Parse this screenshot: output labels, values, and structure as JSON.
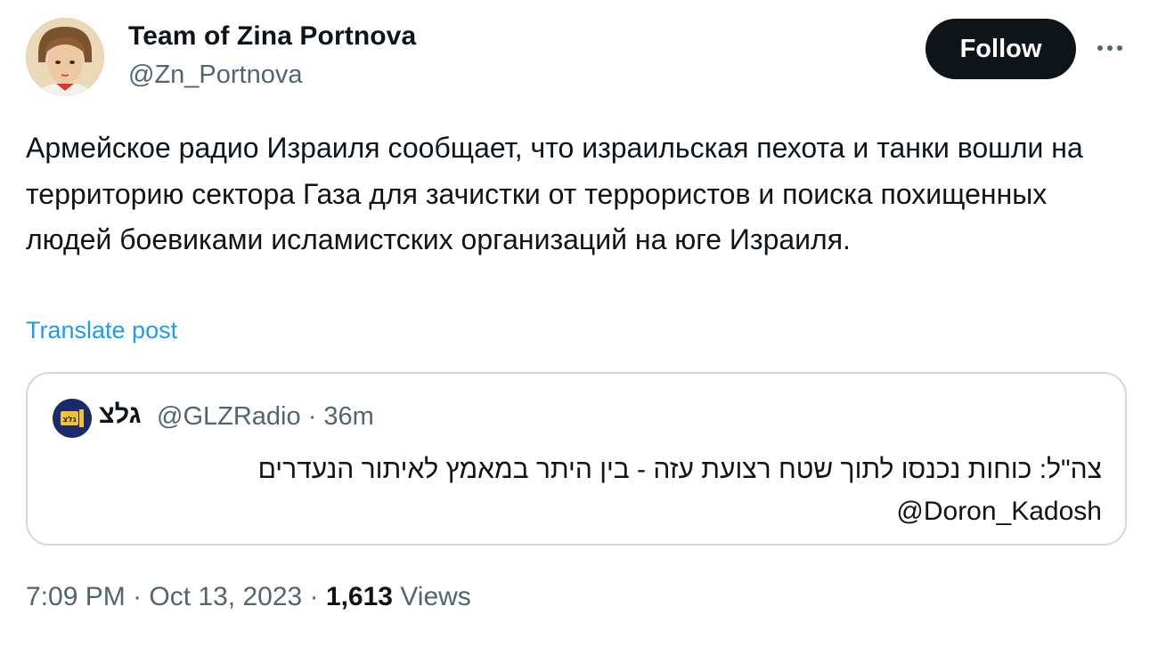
{
  "author": {
    "display_name": "Team of Zina Portnova",
    "handle": "@Zn_Portnova",
    "avatar_icon": "portrait-avatar"
  },
  "actions": {
    "follow_label": "Follow",
    "more_icon": "more-dots-icon"
  },
  "tweet": {
    "text": "Армейское радио Израиля сообщает, что израильская пехота и танки вошли на территорию сектора Газа для зачистки от террористов и поиска похищенных людей боевиками исламистских организаций на юге Израиля.",
    "translate_label": "Translate post"
  },
  "quote": {
    "display_name": "גלצ",
    "handle": "@GLZRadio",
    "separator": "·",
    "time": "36m",
    "text_line1": "צה\"ל: כוחות נכנסו לתוך שטח רצועת עזה - בין היתר במאמץ לאיתור הנעדרים",
    "mention": "@Doron_Kadosh"
  },
  "meta": {
    "time": "7:09 PM",
    "sep1": "·",
    "date": "Oct 13, 2023",
    "sep2": "·",
    "views_count": "1,613",
    "views_label": "Views"
  },
  "colors": {
    "text_primary": "#0f1419",
    "text_secondary": "#536471",
    "link": "#1d9bf0",
    "follow_bg": "#0f1419",
    "border": "#cfd9de"
  }
}
